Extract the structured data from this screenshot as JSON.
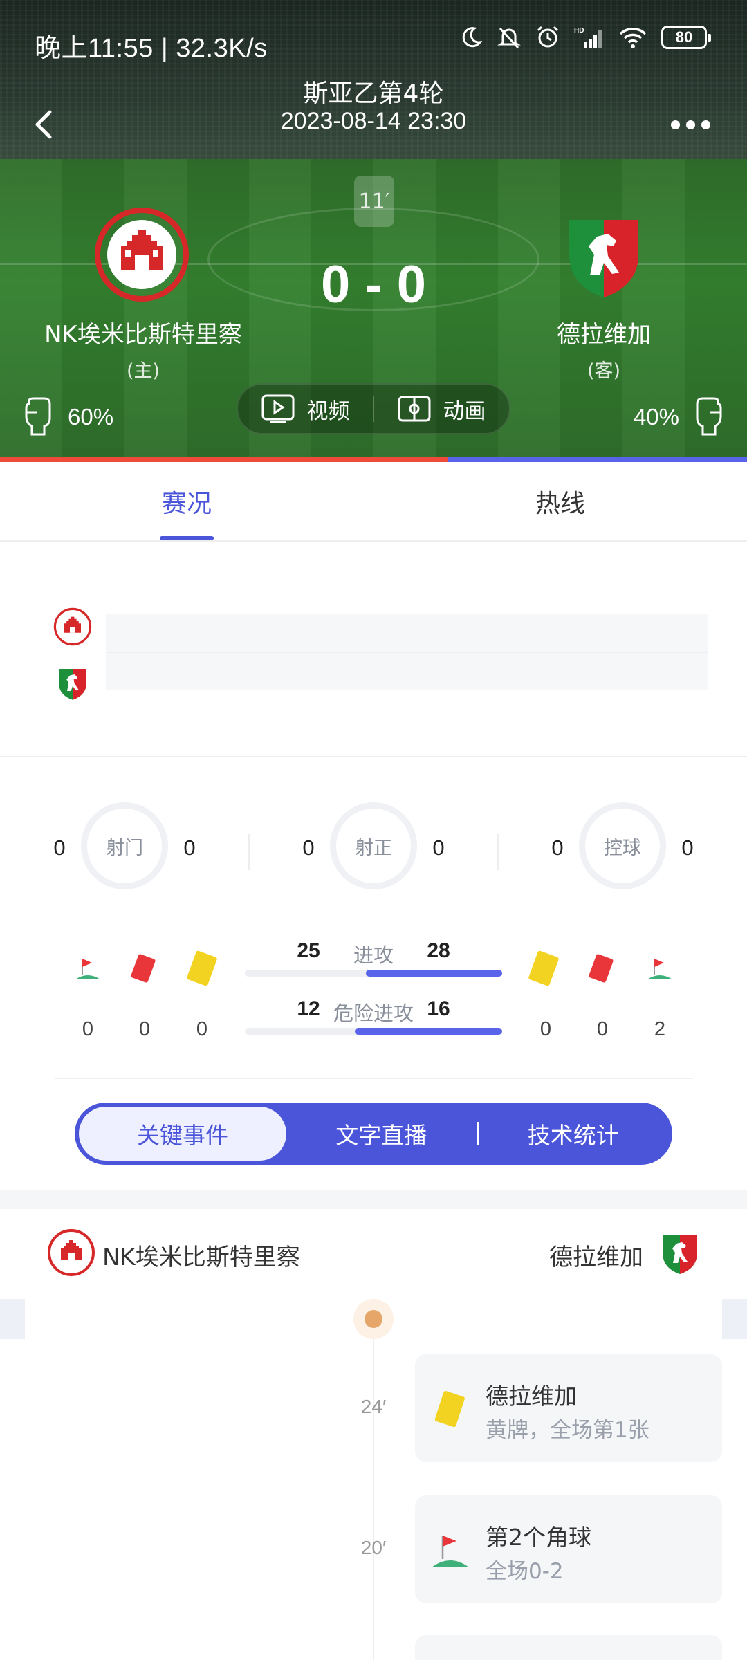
{
  "status_bar": {
    "time_speed": "晚上11:55 | 32.3K/s",
    "battery": "80",
    "icons": [
      "moon-icon",
      "mute-bell-icon",
      "alarm-icon",
      "hd-signal-icon",
      "wifi-icon",
      "battery-icon"
    ]
  },
  "match": {
    "league_round": "斯亚乙第4轮",
    "datetime": "2023-08-14 23:30",
    "minute": "11′",
    "score": "0 - 0",
    "home": {
      "name": "NK埃米比斯特里察",
      "tag": "(主)",
      "possession": "60%",
      "possession_value": 60,
      "color": "#f04a3a"
    },
    "away": {
      "name": "德拉维加",
      "tag": "(客)",
      "possession": "40%",
      "possession_value": 40,
      "color": "#5a64ea"
    }
  },
  "media": {
    "video_label": "视频",
    "animation_label": "动画"
  },
  "tabs": [
    {
      "label": "赛况",
      "active": true
    },
    {
      "label": "热线",
      "active": false
    }
  ],
  "stats": {
    "circles": [
      {
        "label": "射门",
        "home": "0",
        "away": "0"
      },
      {
        "label": "射正",
        "home": "0",
        "away": "0"
      },
      {
        "label": "控球",
        "home": "0",
        "away": "0"
      }
    ],
    "home_counts": {
      "corners": "0",
      "red": "0",
      "yellow": "0"
    },
    "away_counts": {
      "yellow": "0",
      "red": "0",
      "corners": "2"
    },
    "attack": {
      "label": "进攻",
      "home": "25",
      "away": "28",
      "home_value": 25,
      "away_value": 28
    },
    "dangerous_attack": {
      "label": "危险进攻",
      "home": "12",
      "away": "16",
      "home_value": 12,
      "away_value": 16
    }
  },
  "segmented": {
    "key_events": "关键事件",
    "text_live": "文字直播",
    "tech_stats": "技术统计"
  },
  "key_events": {
    "home_name": "NK埃米比斯特里察",
    "away_name": "德拉维加",
    "events": [
      {
        "minute": "24′",
        "title": "德拉维加",
        "detail": "黄牌，全场第1张",
        "icon": "yellow-card-icon"
      },
      {
        "minute": "20′",
        "title": "第2个角球",
        "detail": "全场0-2",
        "icon": "corner-flag-icon"
      }
    ]
  },
  "colors": {
    "accent": "#4b55d9",
    "home_bar": "#f04a3a",
    "away_bar": "#5a64ea",
    "yellow_card": "#f2d321",
    "red_card": "#e8363a"
  }
}
